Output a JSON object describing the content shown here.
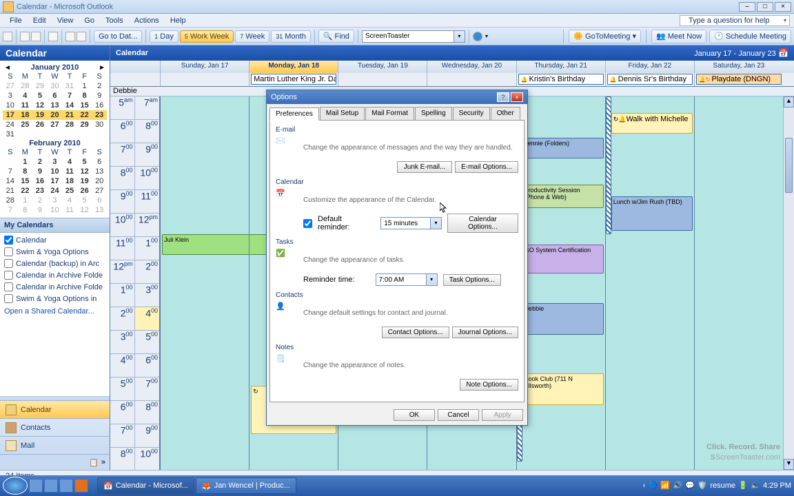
{
  "titlebar": {
    "title": "Calendar - Microsoft Outlook"
  },
  "menubar": {
    "items": [
      "File",
      "Edit",
      "View",
      "Go",
      "Tools",
      "Actions",
      "Help"
    ],
    "ask": "Type a question for help"
  },
  "toolbar": {
    "goto": "Go to Dat...",
    "day": "Day",
    "workweek": "Work Week",
    "week": "Week",
    "month": "Month",
    "find": "Find",
    "st": "ScreenToaster",
    "gotomeeting": "GoToMeeting",
    "meetnow": "Meet Now",
    "schedule": "Schedule Meeting"
  },
  "nav": {
    "head": "Calendar",
    "month1": "January 2010",
    "month2": "February 2010",
    "dow": [
      "S",
      "M",
      "T",
      "W",
      "T",
      "F",
      "S"
    ],
    "mycals": "My Calendars",
    "cals": [
      "Calendar",
      "Swim & Yoga Options",
      "Calendar (backup) in Arc",
      "Calendar in Archive Folde",
      "Calendar in Archive Folde",
      "Swim & Yoga Options in"
    ],
    "open": "Open a Shared Calendar...",
    "btns": [
      "Calendar",
      "Contacts",
      "Mail"
    ]
  },
  "cal": {
    "head": "Calendar",
    "range": "January 17 - January 23",
    "days": [
      "Sunday, Jan 17",
      "Monday, Jan 18",
      "Tuesday, Jan 19",
      "Wednesday, Jan 20",
      "Thursday, Jan 21",
      "Friday, Jan 22",
      "Saturday, Jan 23"
    ],
    "allday": {
      "mon": "Martin Luther King Jr. Day",
      "thu": "Kristin's Birthday",
      "fri": "Dennis Sr's Birthday",
      "sat": "Playdate (DNGN)"
    },
    "events": {
      "debbie": "Debbie",
      "juli": "Juli Klein",
      "walk": "Walk with Michelle",
      "lennie": "Lennie (Folders)",
      "prod": "Productivity Session (Phone & Web)",
      "lunch": "Lunch w/Jim Rush (TBD)",
      "go": "GO System Certification",
      "debbie2": "Debbie",
      "book": "Book Club (711 N Ellsworth)"
    }
  },
  "dialog": {
    "title": "Options",
    "tabs": [
      "Preferences",
      "Mail Setup",
      "Mail Format",
      "Spelling",
      "Security",
      "Other"
    ],
    "email": {
      "lbl": "E-mail",
      "txt": "Change the appearance of messages and the way they are handled.",
      "junk": "Junk E-mail...",
      "opts": "E-mail Options..."
    },
    "calendar": {
      "lbl": "Calendar",
      "txt": "Customize the appearance of the Calendar.",
      "def": "Default reminder:",
      "val": "15 minutes",
      "opts": "Calendar Options..."
    },
    "tasks": {
      "lbl": "Tasks",
      "txt": "Change the appearance of tasks.",
      "rem": "Reminder time:",
      "val": "7:00 AM",
      "opts": "Task Options..."
    },
    "contacts": {
      "lbl": "Contacts",
      "txt": "Change default settings for contact and journal.",
      "copts": "Contact Options...",
      "jopts": "Journal Options..."
    },
    "notes": {
      "lbl": "Notes",
      "txt": "Change the appearance of notes.",
      "opts": "Note Options..."
    },
    "ok": "OK",
    "cancel": "Cancel",
    "apply": "Apply"
  },
  "status": "24 Items",
  "taskbar": {
    "t1": "Calendar - Microsof...",
    "t2": "Jan Wencel | Produc...",
    "tray": {
      "resume": "resume",
      "time": "4:29 PM"
    }
  },
  "watermark": {
    "l1": "Click. Record. Share",
    "l2": "ScreenToaster.com"
  }
}
